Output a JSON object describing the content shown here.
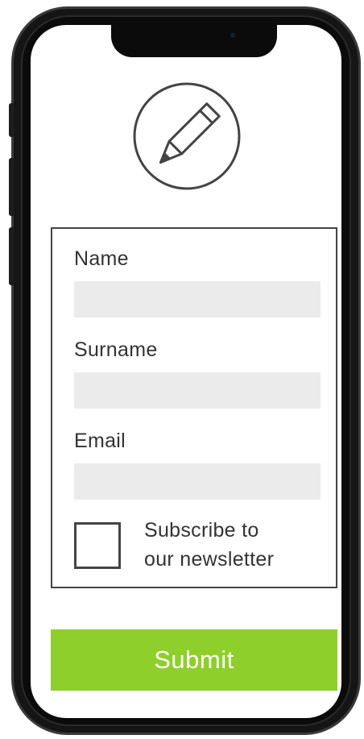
{
  "form": {
    "name_label": "Name",
    "name_value": "",
    "surname_label": "Surname",
    "surname_value": "",
    "email_label": "Email",
    "email_value": "",
    "newsletter_label_line1": "Subscribe to",
    "newsletter_label_line2": "our newsletter",
    "newsletter_checked": false,
    "submit_label": "Submit"
  },
  "icons": {
    "header_icon": "pencil-icon"
  },
  "colors": {
    "submit_background": "#8ecf2b",
    "submit_text": "#ffffff",
    "input_background": "#ebebeb",
    "text": "#333333",
    "frame": "#151515"
  }
}
